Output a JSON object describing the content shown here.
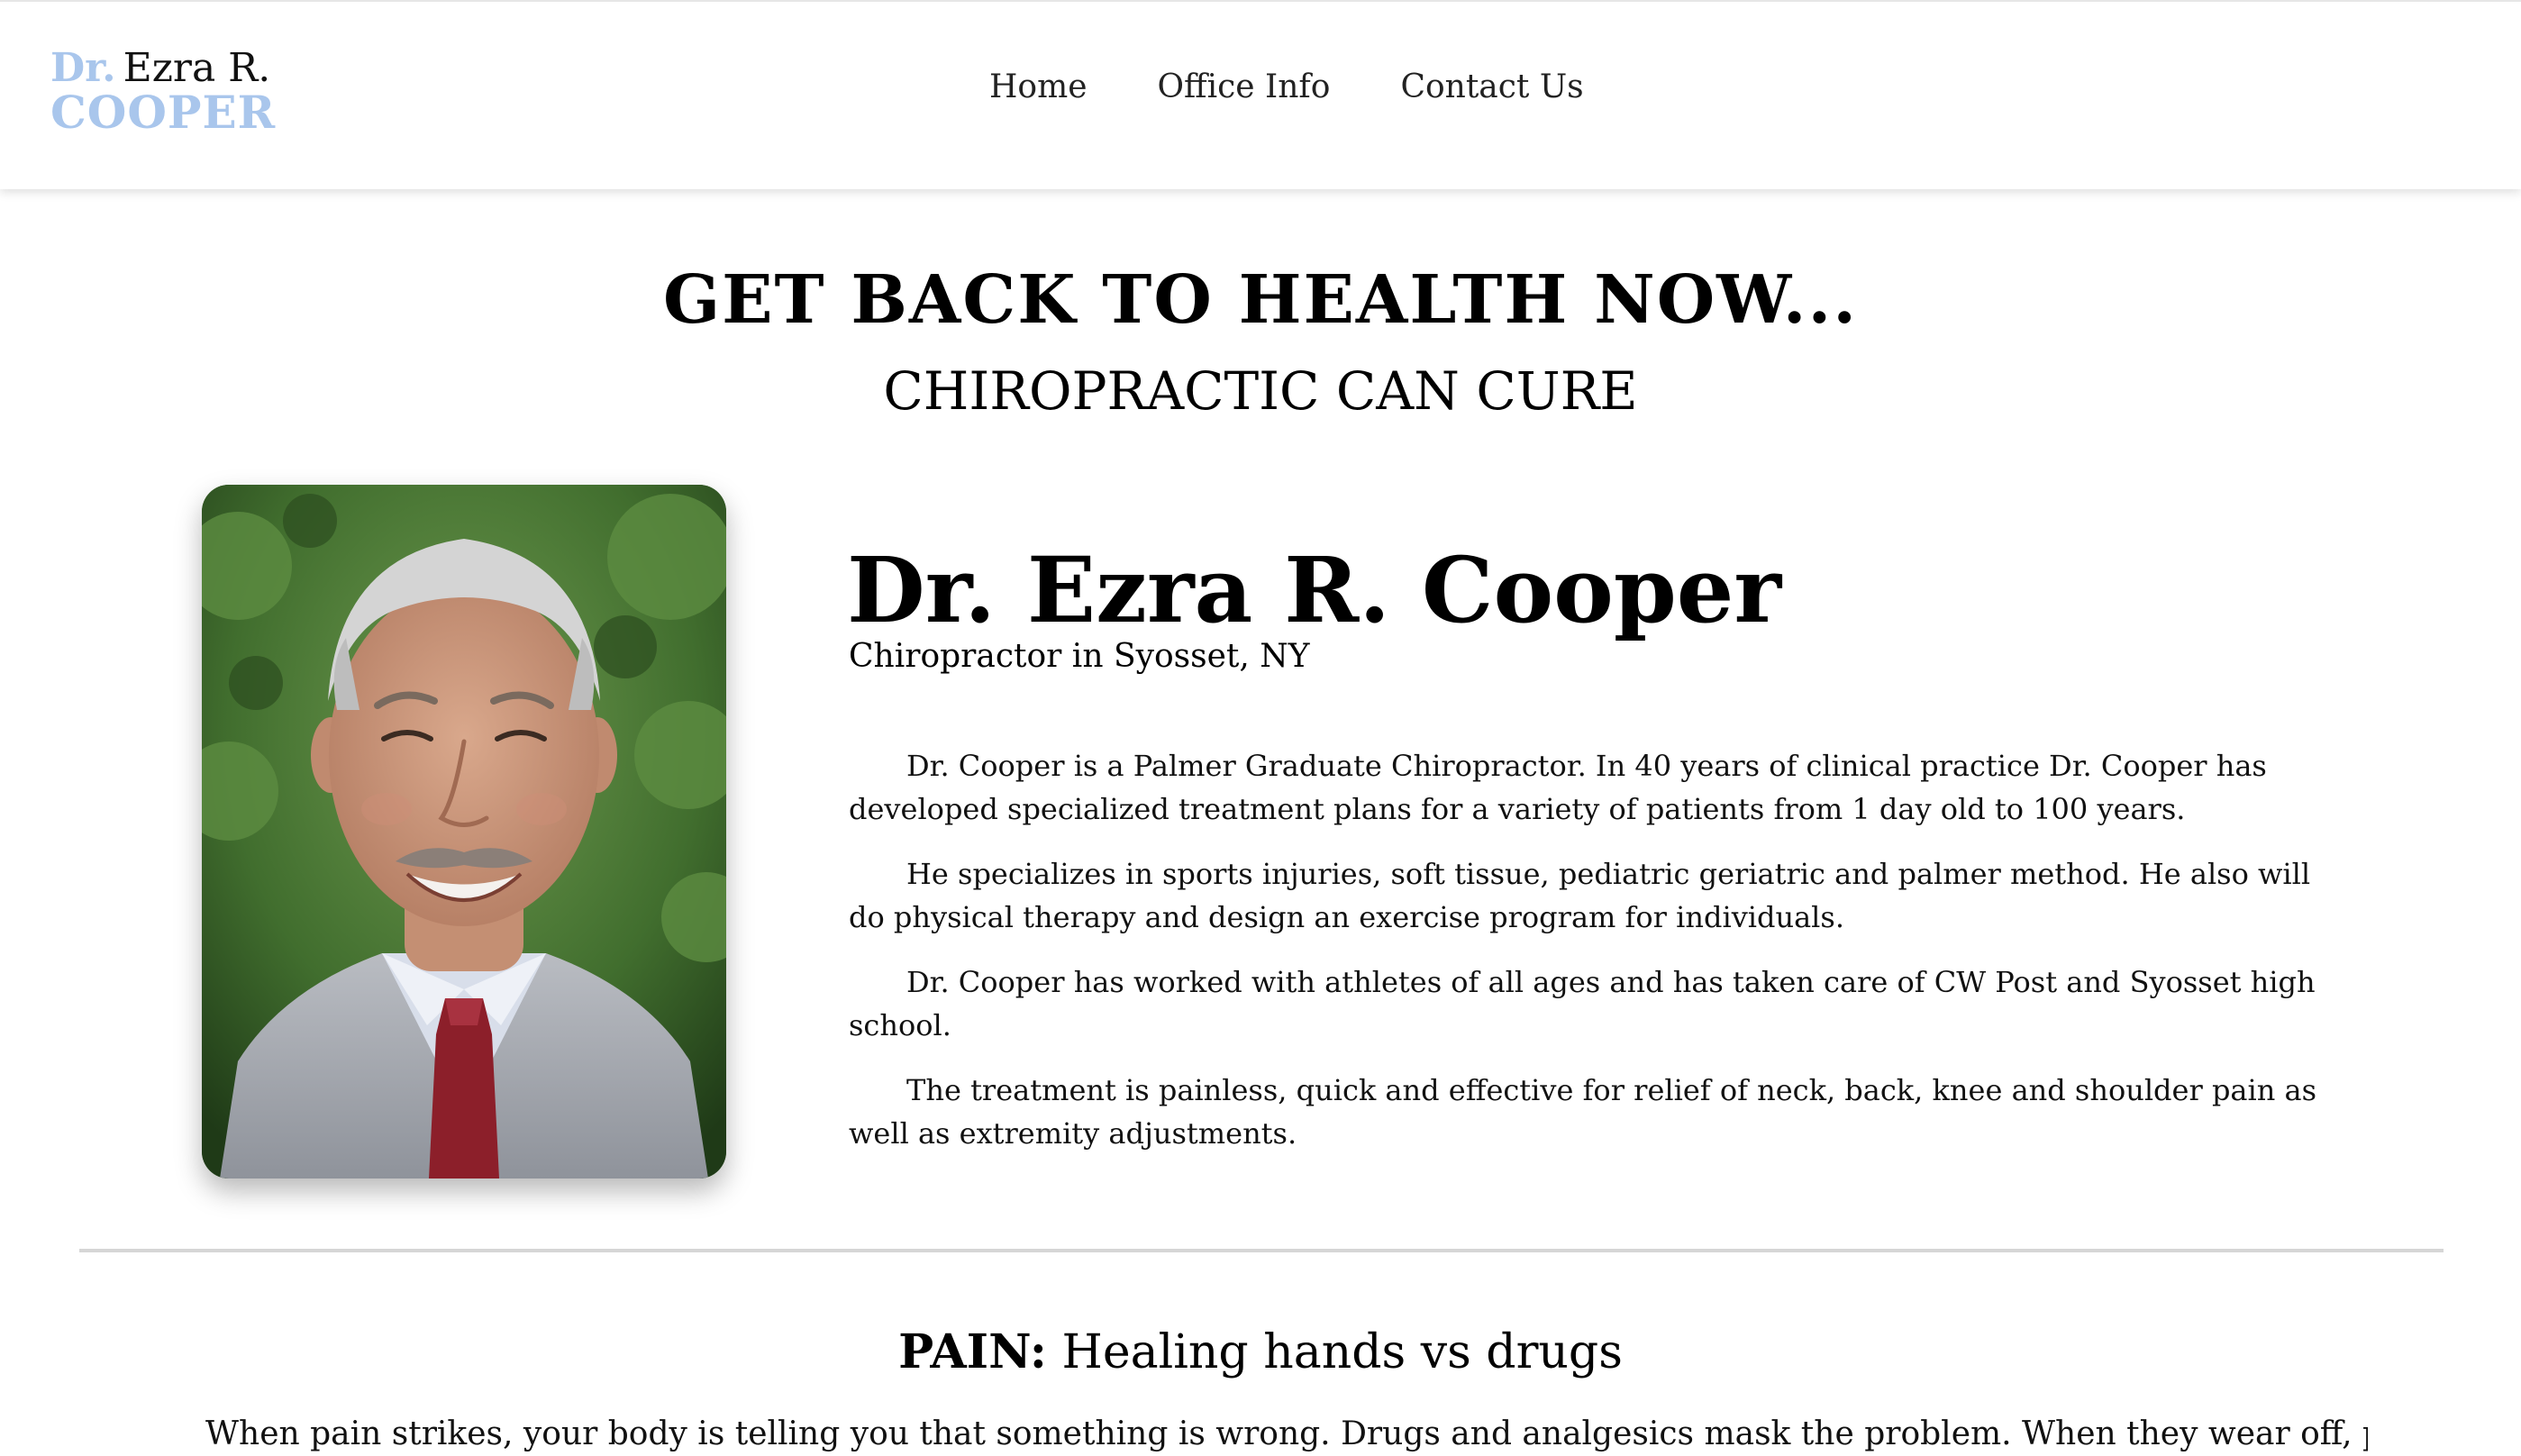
{
  "header": {
    "logo": {
      "dr": "Dr.",
      "name": "Ezra R.",
      "surname": "COOPER"
    },
    "nav": [
      {
        "label": "Home"
      },
      {
        "label": "Office Info"
      },
      {
        "label": "Contact Us"
      }
    ]
  },
  "hero": {
    "title": "GET BACK TO HEALTH NOW...",
    "subtitle": "CHIROPRACTIC CAN CURE"
  },
  "bio": {
    "name": "Dr. Ezra R. Cooper",
    "title": "Chiropractor in Syosset, NY",
    "paragraphs": [
      "Dr. Cooper is a Palmer Graduate Chiropractor. In 40 years of clinical practice Dr. Cooper has developed specialized treatment plans for a variety of patients from 1 day old to 100 years.",
      "He specializes in sports injuries, soft tissue, pediatric geriatric and palmer method. He also will do physical therapy and design an exercise program for individuals.",
      "Dr. Cooper has worked with athletes of all ages and has taken care of CW Post and Syosset high school.",
      "The treatment is painless, quick and effective for relief of neck, back, knee and shoulder pain as well as extremity adjustments."
    ]
  },
  "pain": {
    "heading_strong": "PAIN:",
    "heading_rest": " Healing hands vs drugs",
    "text": "When pain strikes, your body is telling you that something is wrong. Drugs and analgesics mask the problem. When they wear off, pain returns. Our"
  },
  "colors": {
    "brand_light_blue": "#a9c6ec",
    "divider": "#d6d6d6"
  }
}
